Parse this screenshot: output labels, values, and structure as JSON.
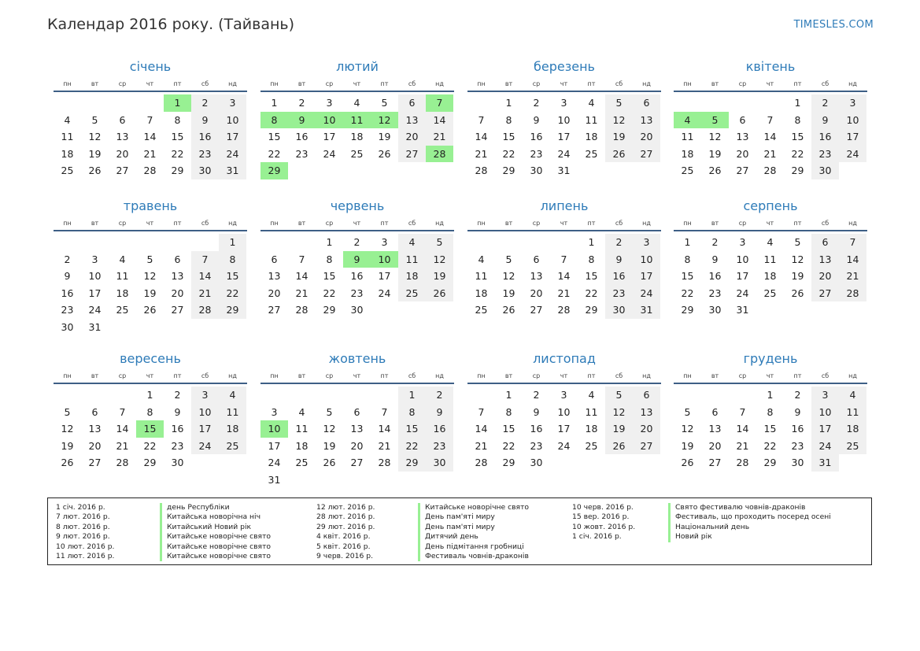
{
  "header": {
    "title": "Календар 2016 року. (Тайвань)",
    "site": "TIMESLES.COM"
  },
  "weekdays": [
    "пн",
    "вт",
    "ср",
    "чт",
    "пт",
    "сб",
    "нд"
  ],
  "colors": {
    "accent": "#2e7bb8",
    "rule": "#3e5f86",
    "holiday": "#98f093",
    "weekend": "#f0f0f0"
  },
  "months": [
    {
      "name": "січень",
      "offset": 4,
      "days": 31,
      "holidays": [
        1
      ]
    },
    {
      "name": "лютий",
      "offset": 0,
      "days": 29,
      "holidays": [
        7,
        8,
        9,
        10,
        11,
        12,
        28,
        29
      ]
    },
    {
      "name": "березень",
      "offset": 1,
      "days": 31,
      "holidays": []
    },
    {
      "name": "квітень",
      "offset": 4,
      "days": 30,
      "holidays": [
        4,
        5
      ]
    },
    {
      "name": "травень",
      "offset": 6,
      "days": 31,
      "holidays": []
    },
    {
      "name": "червень",
      "offset": 2,
      "days": 30,
      "holidays": [
        9,
        10
      ]
    },
    {
      "name": "липень",
      "offset": 4,
      "days": 31,
      "holidays": []
    },
    {
      "name": "серпень",
      "offset": 0,
      "days": 31,
      "holidays": []
    },
    {
      "name": "вересень",
      "offset": 3,
      "days": 30,
      "holidays": [
        15
      ]
    },
    {
      "name": "жовтень",
      "offset": 5,
      "days": 31,
      "holidays": [
        10
      ]
    },
    {
      "name": "листопад",
      "offset": 1,
      "days": 30,
      "holidays": []
    },
    {
      "name": "грудень",
      "offset": 3,
      "days": 31,
      "holidays": []
    }
  ],
  "holiday_list": [
    {
      "date": "1 січ. 2016 р.",
      "name": "день Республіки"
    },
    {
      "date": "7 лют. 2016 р.",
      "name": "Китайська новорічна ніч"
    },
    {
      "date": "8 лют. 2016 р.",
      "name": "Китайський Новий рік"
    },
    {
      "date": "9 лют. 2016 р.",
      "name": "Китайське новорічне свято"
    },
    {
      "date": "10 лют. 2016 р.",
      "name": "Китайське новорічне свято"
    },
    {
      "date": "11 лют. 2016 р.",
      "name": "Китайське новорічне свято"
    },
    {
      "date": "12 лют. 2016 р.",
      "name": "Китайське новорічне свято"
    },
    {
      "date": "28 лют. 2016 р.",
      "name": "День пам'яті миру"
    },
    {
      "date": "29 лют. 2016 р.",
      "name": "День пам'яті миру"
    },
    {
      "date": "4 квіт. 2016 р.",
      "name": "Дитячий день"
    },
    {
      "date": "5 квіт. 2016 р.",
      "name": "День підмітання гробниці"
    },
    {
      "date": "9 черв. 2016 р.",
      "name": "Фестиваль човнів-драконів"
    },
    {
      "date": "10 черв. 2016 р.",
      "name": "Свято фестивалю човнів-драконів"
    },
    {
      "date": "15 вер. 2016 р.",
      "name": "Фестиваль, що проходить посеред осені"
    },
    {
      "date": "10 жовт. 2016 р.",
      "name": "Національний день"
    },
    {
      "date": "1 січ. 2016 р.",
      "name": "Новий рік"
    }
  ]
}
